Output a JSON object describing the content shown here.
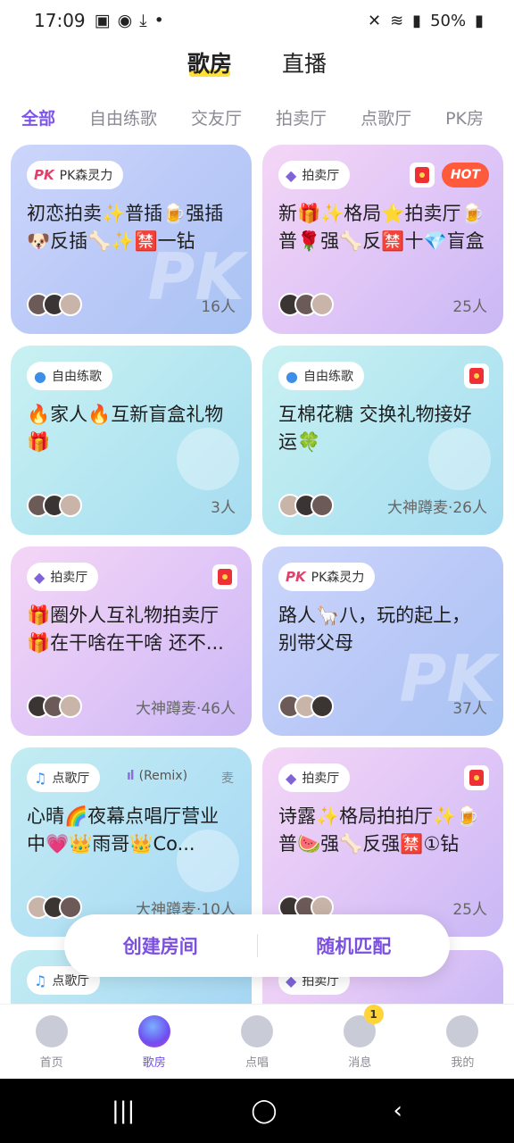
{
  "status_bar": {
    "time": "17:09",
    "battery": "50%",
    "left_icons": [
      "gallery-icon",
      "app-icon",
      "download-icon",
      "dot-icon"
    ],
    "right_icons": [
      "mute-icon",
      "wifi-icon",
      "signal-icon",
      "battery-icon"
    ]
  },
  "top_tabs": [
    {
      "label": "歌房",
      "active": true
    },
    {
      "label": "直播",
      "active": false
    }
  ],
  "categories": [
    {
      "label": "全部",
      "active": true
    },
    {
      "label": "自由练歌",
      "active": false
    },
    {
      "label": "交友厅",
      "active": false
    },
    {
      "label": "拍卖厅",
      "active": false
    },
    {
      "label": "点歌厅",
      "active": false
    },
    {
      "label": "PK房",
      "active": false
    }
  ],
  "cards": [
    {
      "type": "pk",
      "tag_icon": "PK",
      "tag": "PK森灵力",
      "title": "初恋拍卖✨普插🍺强插🐶反插🦴✨🈲一钻",
      "count": "16人",
      "badges": []
    },
    {
      "type": "auction",
      "tag_icon": "◆",
      "tag": "拍卖厅",
      "title": "新🎁✨格局⭐拍卖厅🍺普🌹强🦴反🈲十💎盲盒",
      "count": "25人",
      "badges": [
        "redpack",
        "HOT"
      ]
    },
    {
      "type": "free",
      "tag_icon": "●",
      "tag": "自由练歌",
      "title": "🔥家人🔥互新盲盒礼物🎁",
      "count": "3人",
      "badges": []
    },
    {
      "type": "free",
      "tag_icon": "●",
      "tag": "自由练歌",
      "title": "互棉花糖 交换礼物接好运🍀",
      "count": "大神蹲麦·26人",
      "badges": [
        "redpack"
      ]
    },
    {
      "type": "auction",
      "tag_icon": "◆",
      "tag": "拍卖厅",
      "title": "🎁圈外人互礼物拍卖厅🎁在干啥在干啥 还不...",
      "count": "大神蹲麦·46人",
      "badges": [
        "redpack"
      ]
    },
    {
      "type": "pk",
      "tag_icon": "PK",
      "tag": "PK森灵力",
      "title": "路人🦙八，玩的起上，别带父母",
      "count": "37人",
      "badges": []
    },
    {
      "type": "song",
      "tag_icon": "♫",
      "tag": "点歌厅",
      "title": "心晴🌈夜幕点唱厅营业中💗👑雨哥👑Co...",
      "count": "大神蹲麦·10人",
      "badges": [],
      "music": "(Remix)",
      "mic": "麦"
    },
    {
      "type": "auction",
      "tag_icon": "◆",
      "tag": "拍卖厅",
      "title": "诗露✨格局拍拍厅✨🍺普🍉强🦴反强🈲①钻",
      "count": "25人",
      "badges": [
        "redpack"
      ]
    }
  ],
  "peek_cards": [
    {
      "type": "song",
      "tag_icon": "♫",
      "tag": "点歌厅"
    },
    {
      "type": "auction",
      "tag_icon": "◆",
      "tag": "拍卖厅"
    }
  ],
  "actions": {
    "create_room": "创建房间",
    "random_match": "随机匹配"
  },
  "bottom_nav": [
    {
      "label": "首页",
      "icon": "home-icon",
      "active": false
    },
    {
      "label": "歌房",
      "icon": "song-room-icon",
      "active": true
    },
    {
      "label": "点唱",
      "icon": "sing-icon",
      "active": false
    },
    {
      "label": "消息",
      "icon": "message-icon",
      "active": false,
      "badge": "1"
    },
    {
      "label": "我的",
      "icon": "profile-icon",
      "active": false
    }
  ],
  "colors": {
    "accent": "#7f54ec",
    "highlight": "#ffe13b",
    "redpack": "#ee3034",
    "hot": "#ff5a3c"
  }
}
